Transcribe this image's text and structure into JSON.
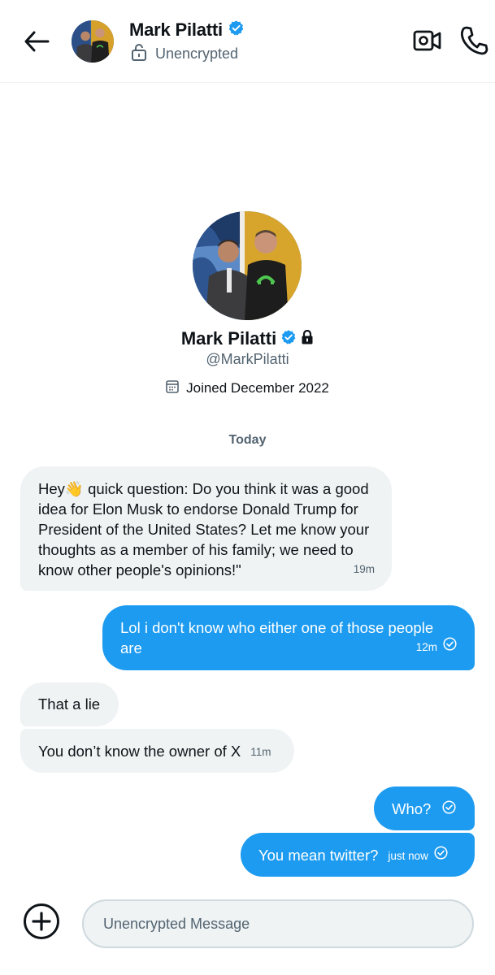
{
  "header": {
    "name": "Mark Pilatti",
    "status": "Unencrypted",
    "icons": [
      "back-arrow-icon",
      "verified-badge-icon",
      "unlock-icon",
      "video-call-icon",
      "phone-call-icon"
    ]
  },
  "profile": {
    "name": "Mark Pilatti",
    "handle": "@MarkPilatti",
    "joined": "Joined December 2022",
    "icons": [
      "verified-badge-icon",
      "lock-icon",
      "calendar-icon"
    ]
  },
  "date_separator": "Today",
  "messages": [
    {
      "direction": "incoming",
      "before_emoji": "Hey",
      "emoji": "👋",
      "text": " quick question: Do you think it was a good idea for Elon Musk to endorse Donald Trump for President of the United States? Let me know your thoughts as a member of his family; we need to know other people's opinions!\"",
      "time": "19m"
    },
    {
      "direction": "outgoing",
      "text": "Lol i don't know who either one of those people are",
      "time": "12m",
      "read": true
    },
    {
      "direction": "incoming",
      "text": "That a lie",
      "time": ""
    },
    {
      "direction": "incoming",
      "text": "You don’t know the owner of X",
      "time": "11m"
    },
    {
      "direction": "outgoing",
      "text": "Who?",
      "time": "",
      "read": true
    },
    {
      "direction": "outgoing",
      "text": "You mean twitter?",
      "time": "just now",
      "read": true
    }
  ],
  "composer": {
    "placeholder": "Unencrypted Message",
    "value": ""
  },
  "colors": {
    "accent": "#1d9bf0",
    "incoming_bubble": "#eff3f4",
    "text_primary": "#0f1419",
    "text_secondary": "#536471"
  }
}
